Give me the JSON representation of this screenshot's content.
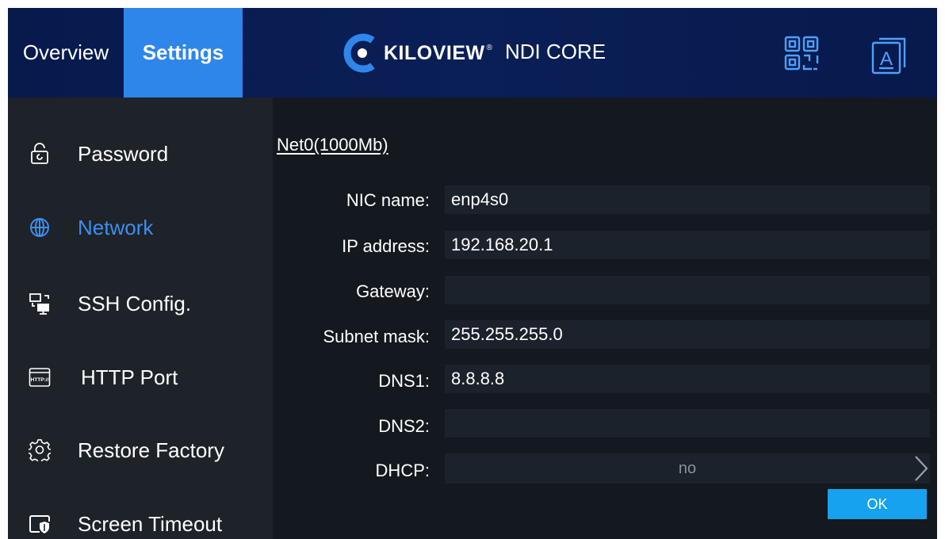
{
  "header": {
    "tabs": [
      {
        "label": "Overview",
        "active": false
      },
      {
        "label": "Settings",
        "active": true
      }
    ],
    "brand": "KILOVIEW",
    "brand_reg": "®",
    "product": "NDI CORE",
    "icons": {
      "qr": "qr-code-icon",
      "language": "language-icon"
    },
    "lang_letter": "A"
  },
  "sidebar": {
    "items": [
      {
        "label": "Password",
        "icon": "lock-icon",
        "active": false
      },
      {
        "label": "Network",
        "icon": "globe-icon",
        "active": true
      },
      {
        "label": "SSH Config.",
        "icon": "ssh-terminal-icon",
        "active": false
      },
      {
        "label": "HTTP Port",
        "icon": "http-browser-icon",
        "active": false
      },
      {
        "label": "Restore Factory",
        "icon": "gear-icon",
        "active": false
      },
      {
        "label": "Screen Timeout",
        "icon": "screen-shield-icon",
        "active": false
      }
    ],
    "http_icon_text": "HTTP://"
  },
  "network": {
    "section_title": "Net0(1000Mb)",
    "fields": [
      {
        "label": "NIC name:",
        "value": "enp4s0"
      },
      {
        "label": "IP address:",
        "value": "192.168.20.1"
      },
      {
        "label": "Gateway:",
        "value": ""
      },
      {
        "label": "Subnet mask:",
        "value": "255.255.255.0"
      },
      {
        "label": "DNS1:",
        "value": "8.8.8.8"
      },
      {
        "label": "DNS2:",
        "value": ""
      }
    ],
    "dhcp": {
      "label": "DHCP:",
      "value": "no"
    },
    "ok_label": "OK"
  },
  "colors": {
    "header_bg": "#0a1f57",
    "active_tab": "#2f86ea",
    "active_menu_text": "#3d8fef",
    "sidebar_bg": "#1e2229",
    "content_bg": "#14181f",
    "field_bg": "#1c222c",
    "ok_button": "#17a2ef"
  }
}
